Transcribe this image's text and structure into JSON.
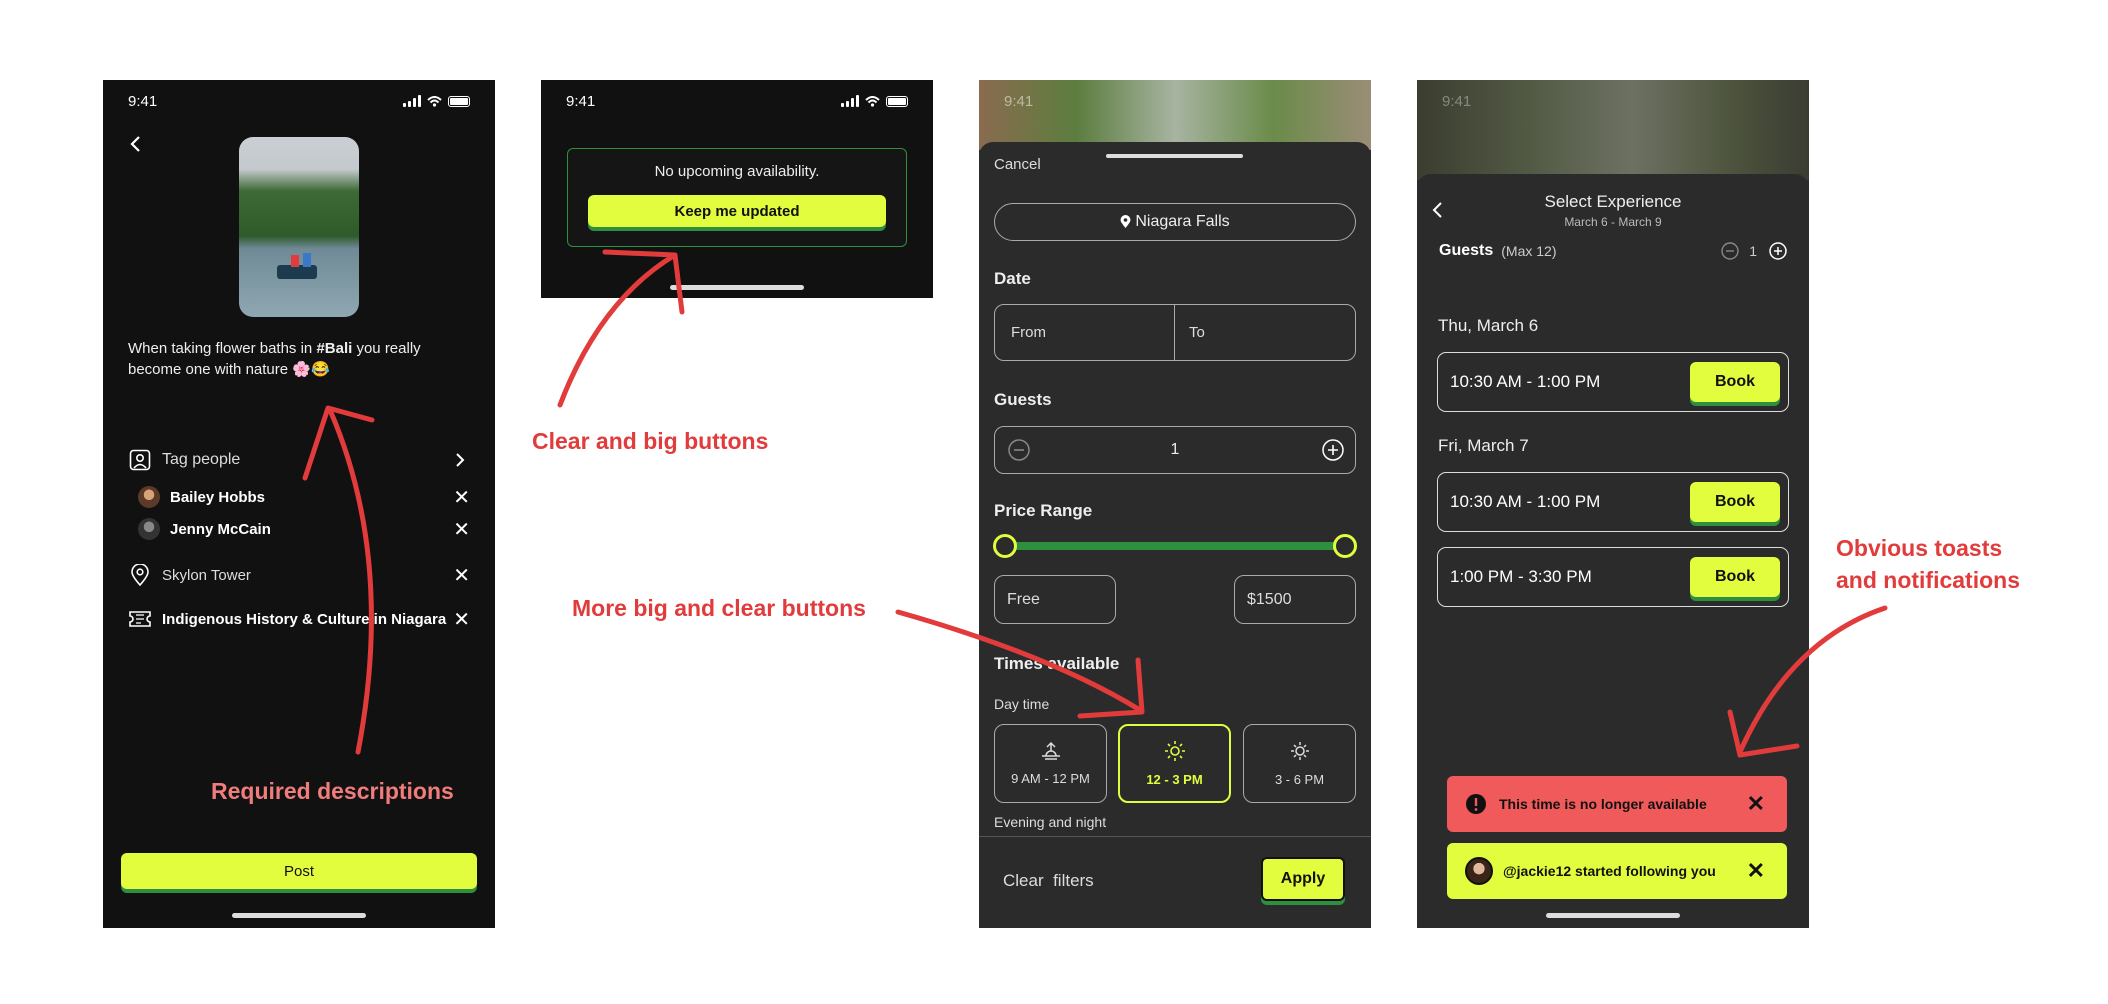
{
  "status_time": "9:41",
  "colors": {
    "accent": "#e2fd3d",
    "annotation": "#e23b3b",
    "error_toast": "#f05a5a",
    "slider_green": "#2e8f3e"
  },
  "screen1": {
    "caption_pre": "When taking flower baths in ",
    "caption_tag": "#Bali",
    "caption_post": " you really become one with nature 🌸😂",
    "tag_people": "Tag people",
    "people": [
      "Bailey Hobbs",
      "Jenny McCain"
    ],
    "location": "Skylon Tower",
    "experience": "Indigenous History & Culture in Niagara",
    "post_button": "Post"
  },
  "screen2": {
    "message": "No upcoming availability.",
    "button": "Keep me updated"
  },
  "screen3": {
    "cancel": "Cancel",
    "location": "Niagara Falls",
    "date_label": "Date",
    "from_placeholder": "From",
    "to_placeholder": "To",
    "guests_label": "Guests",
    "guests_value": "1",
    "price_label": "Price Range",
    "price_min": "Free",
    "price_max": "$1500",
    "times_label": "Times available",
    "day_time_label": "Day time",
    "time_options": [
      "9 AM - 12 PM",
      "12 - 3 PM",
      "3 - 6 PM"
    ],
    "evening_label": "Evening and night",
    "clear_filters": "Clear  filters",
    "apply": "Apply"
  },
  "screen4": {
    "title": "Select Experience",
    "dates": "March 6 - March 9",
    "guests_label": "Guests",
    "guests_max": "(Max 12)",
    "guests_value": "1",
    "day1": "Thu, March 6",
    "day2": "Fri, March 7",
    "slots": [
      "10:30 AM - 1:00 PM",
      "10:30 AM - 1:00 PM",
      "1:00 PM - 3:30 PM"
    ],
    "book": "Book",
    "toast_error": "This time is no longer available",
    "toast_follow": "@jackie12 started following you"
  },
  "annotations": {
    "required": "Required descriptions",
    "clear_big": "Clear and big buttons",
    "more_big": "More big and clear buttons",
    "toasts_1": "Obvious toasts",
    "toasts_2": "and notifications"
  }
}
